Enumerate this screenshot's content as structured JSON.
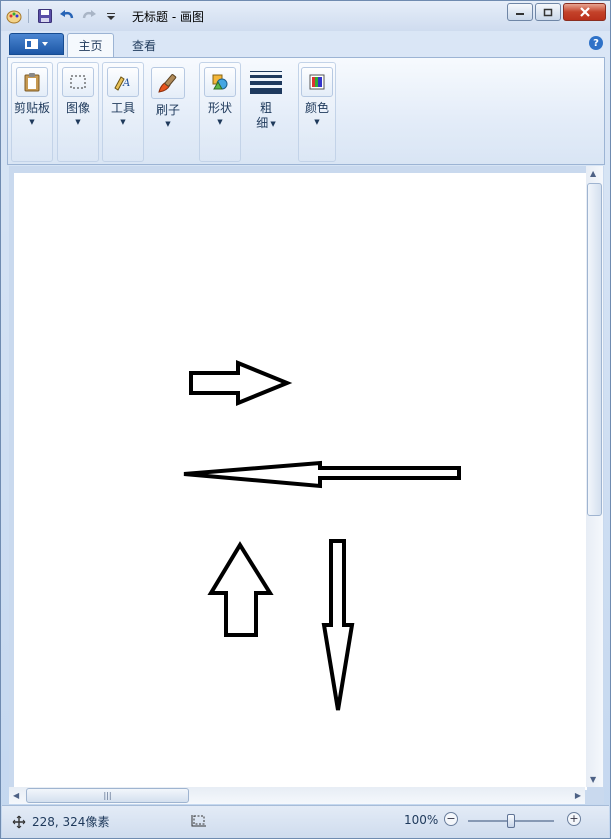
{
  "window": {
    "title": "无标题 - 画图"
  },
  "tabs": [
    {
      "label": "主页"
    },
    {
      "label": "查看"
    }
  ],
  "ribbon": {
    "groups": [
      {
        "label": "剪贴板",
        "icon": "clipboard-icon"
      },
      {
        "label": "图像",
        "icon": "select-icon"
      },
      {
        "label": "工具",
        "icon": "tools-icon"
      },
      {
        "label": "刷子",
        "icon": "brush-icon"
      },
      {
        "label": "形状",
        "icon": "shapes-icon"
      },
      {
        "label_line1": "粗",
        "label_line2": "细",
        "icon": "line-width-icon"
      },
      {
        "label": "颜色",
        "icon": "colors-icon"
      }
    ]
  },
  "status": {
    "cursor_position": "228, 324像素",
    "zoom_level": "100%"
  },
  "colors": {
    "app_button": "#2a67b8",
    "close_button": "#c4422a",
    "drawing_stroke": "#000000"
  }
}
